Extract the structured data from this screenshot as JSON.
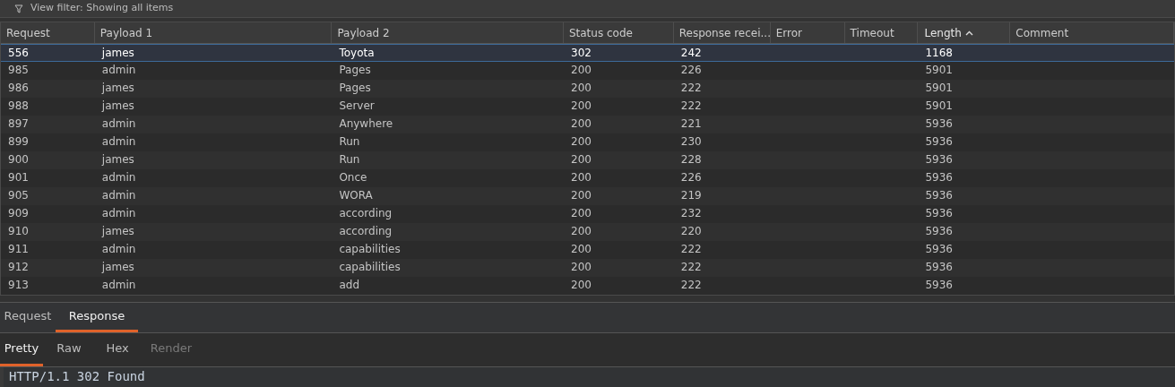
{
  "filter_bar": {
    "text": "View filter: Showing all items"
  },
  "table": {
    "columns": [
      {
        "label": "Request",
        "sorted": false
      },
      {
        "label": "Payload 1",
        "sorted": false
      },
      {
        "label": "Payload 2",
        "sorted": false
      },
      {
        "label": "Status code",
        "sorted": false
      },
      {
        "label": "Response recei...",
        "sorted": false
      },
      {
        "label": "Error",
        "sorted": false
      },
      {
        "label": "Timeout",
        "sorted": false
      },
      {
        "label": "Length",
        "sorted": true
      },
      {
        "label": "Comment",
        "sorted": false
      }
    ],
    "rows": [
      {
        "cells": [
          "556",
          "james",
          "Toyota",
          "302",
          "242",
          "",
          "",
          "1168",
          ""
        ],
        "selected": true
      },
      {
        "cells": [
          "985",
          "admin",
          "Pages",
          "200",
          "226",
          "",
          "",
          "5901",
          ""
        ],
        "selected": false
      },
      {
        "cells": [
          "986",
          "james",
          "Pages",
          "200",
          "222",
          "",
          "",
          "5901",
          ""
        ],
        "selected": false
      },
      {
        "cells": [
          "988",
          "james",
          "Server",
          "200",
          "222",
          "",
          "",
          "5901",
          ""
        ],
        "selected": false
      },
      {
        "cells": [
          "897",
          "admin",
          "Anywhere",
          "200",
          "221",
          "",
          "",
          "5936",
          ""
        ],
        "selected": false
      },
      {
        "cells": [
          "899",
          "admin",
          "Run",
          "200",
          "230",
          "",
          "",
          "5936",
          ""
        ],
        "selected": false
      },
      {
        "cells": [
          "900",
          "james",
          "Run",
          "200",
          "228",
          "",
          "",
          "5936",
          ""
        ],
        "selected": false
      },
      {
        "cells": [
          "901",
          "admin",
          "Once",
          "200",
          "226",
          "",
          "",
          "5936",
          ""
        ],
        "selected": false
      },
      {
        "cells": [
          "905",
          "admin",
          "WORA",
          "200",
          "219",
          "",
          "",
          "5936",
          ""
        ],
        "selected": false
      },
      {
        "cells": [
          "909",
          "admin",
          "according",
          "200",
          "232",
          "",
          "",
          "5936",
          ""
        ],
        "selected": false
      },
      {
        "cells": [
          "910",
          "james",
          "according",
          "200",
          "220",
          "",
          "",
          "5936",
          ""
        ],
        "selected": false
      },
      {
        "cells": [
          "911",
          "admin",
          "capabilities",
          "200",
          "222",
          "",
          "",
          "5936",
          ""
        ],
        "selected": false
      },
      {
        "cells": [
          "912",
          "james",
          "capabilities",
          "200",
          "222",
          "",
          "",
          "5936",
          ""
        ],
        "selected": false
      },
      {
        "cells": [
          "913",
          "admin",
          "add",
          "200",
          "222",
          "",
          "",
          "5936",
          ""
        ],
        "selected": false
      }
    ]
  },
  "tabs": [
    {
      "label": "Request",
      "selected": false
    },
    {
      "label": "Response",
      "selected": true
    }
  ],
  "view_tabs": [
    {
      "label": "Pretty",
      "selected": true,
      "disabled": false
    },
    {
      "label": "Raw",
      "selected": false,
      "disabled": false
    },
    {
      "label": "Hex",
      "selected": false,
      "disabled": false
    },
    {
      "label": "Render",
      "selected": false,
      "disabled": true
    }
  ],
  "editor": {
    "lines": [
      "HTTP/1.1 302 Found"
    ]
  }
}
